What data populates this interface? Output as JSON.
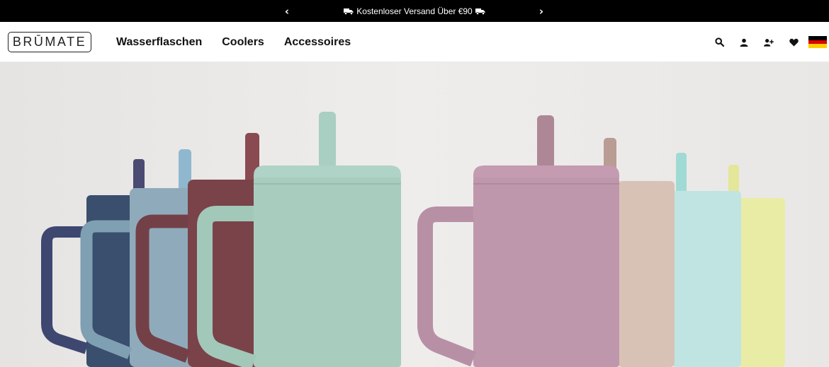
{
  "announcement": {
    "prev_label": "‹",
    "next_label": "›",
    "message": "Kostenloser Versand Über €90"
  },
  "header": {
    "logo_text": "BRŪMATE",
    "nav": [
      {
        "label": "Wasserflaschen"
      },
      {
        "label": "Coolers"
      },
      {
        "label": "Accessoires"
      }
    ],
    "icons": [
      "search-icon",
      "account-icon",
      "add-user-icon",
      "wishlist-heart-icon",
      "germany-flag-icon"
    ]
  },
  "colors": {
    "announcement_bg": "#000000",
    "flag_black": "#000000",
    "flag_red": "#DD0000",
    "flag_gold": "#FFCE00"
  }
}
